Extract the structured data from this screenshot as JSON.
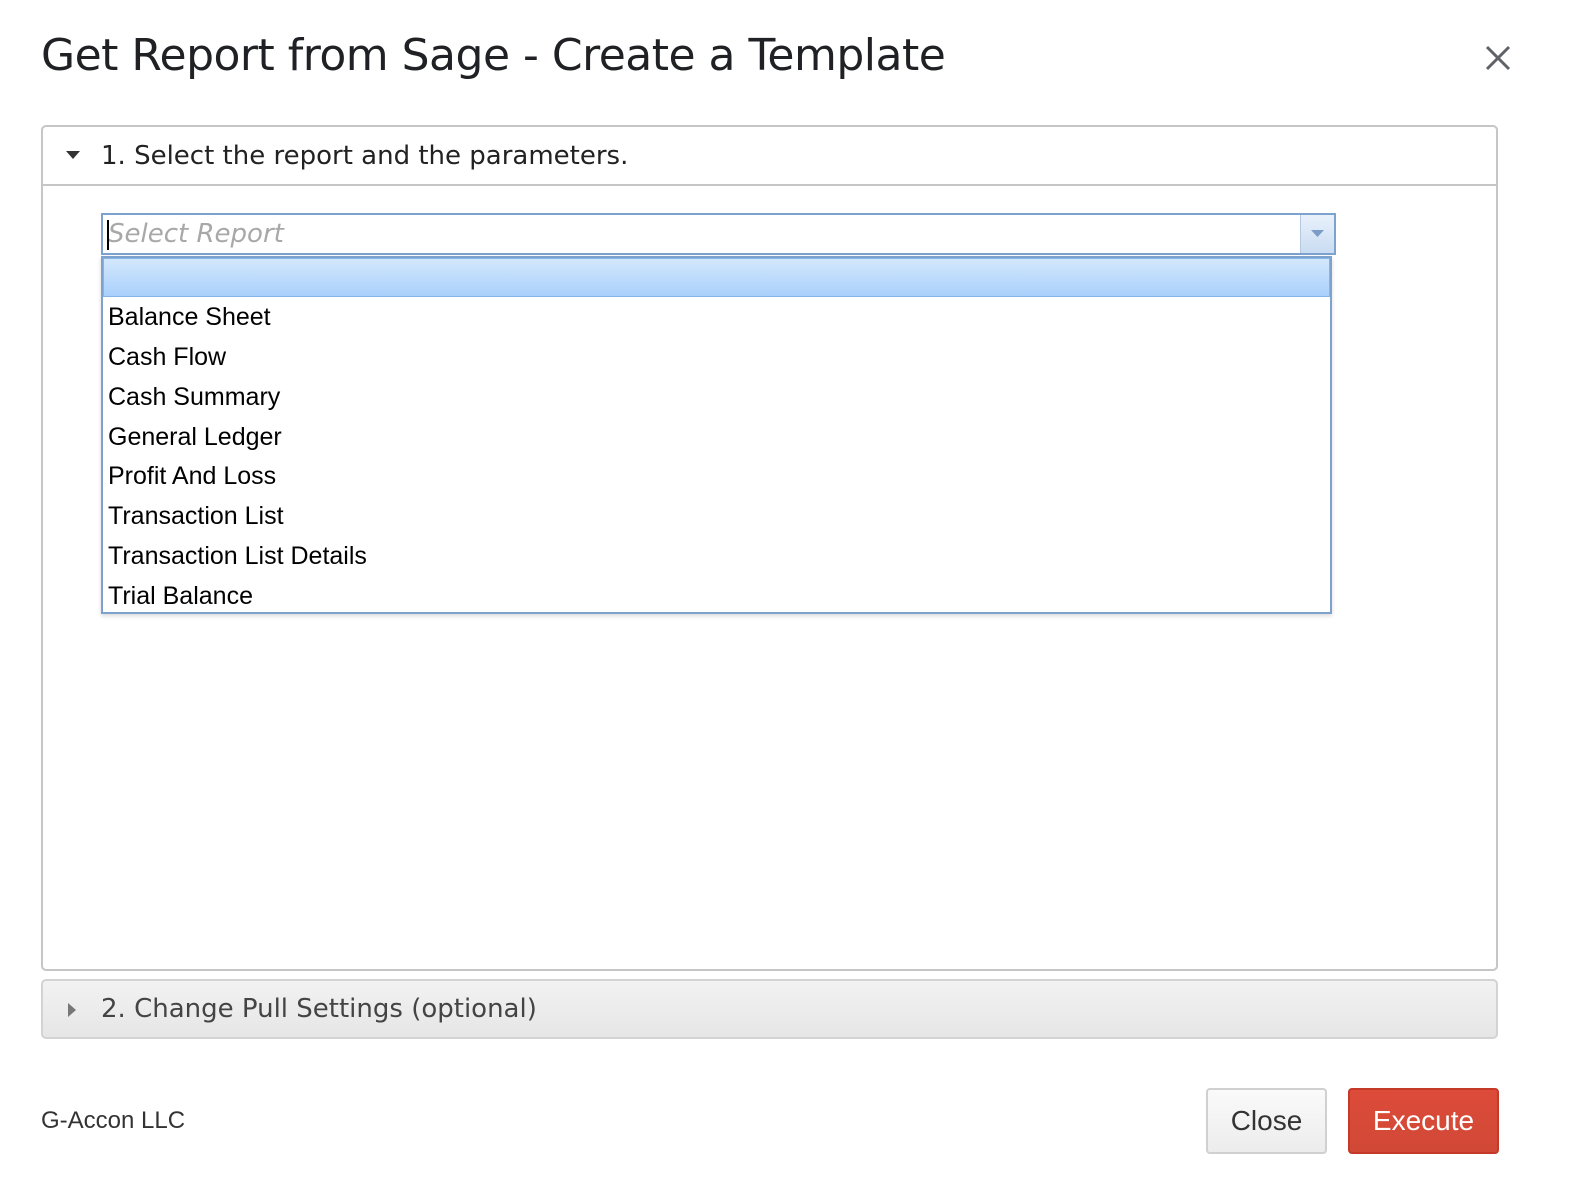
{
  "dialog": {
    "title": "Get Report from Sage - Create a Template"
  },
  "step1": {
    "title": "1. Select the report and the parameters.",
    "expanded": true,
    "report_select": {
      "placeholder": "Select Report",
      "value": "",
      "options": [
        "",
        "Balance Sheet",
        "Cash Flow",
        "Cash Summary",
        "General Ledger",
        "Profit And Loss",
        "Transaction List",
        "Transaction List Details",
        "Trial Balance"
      ],
      "highlighted_index": 0
    }
  },
  "step2": {
    "title": "2. Change Pull Settings (optional)",
    "expanded": false
  },
  "footer": {
    "brand": "G-Accon LLC",
    "close_label": "Close",
    "execute_label": "Execute"
  },
  "colors": {
    "execute_bg": "#d14836",
    "highlight_bg": "#a9d0fb",
    "combo_border": "#7da2ce"
  },
  "icons": {
    "close": "close-icon",
    "expanded_caret": "caret-down-icon",
    "collapsed_caret": "caret-right-icon",
    "dropdown_arrow": "chevron-down-icon"
  }
}
